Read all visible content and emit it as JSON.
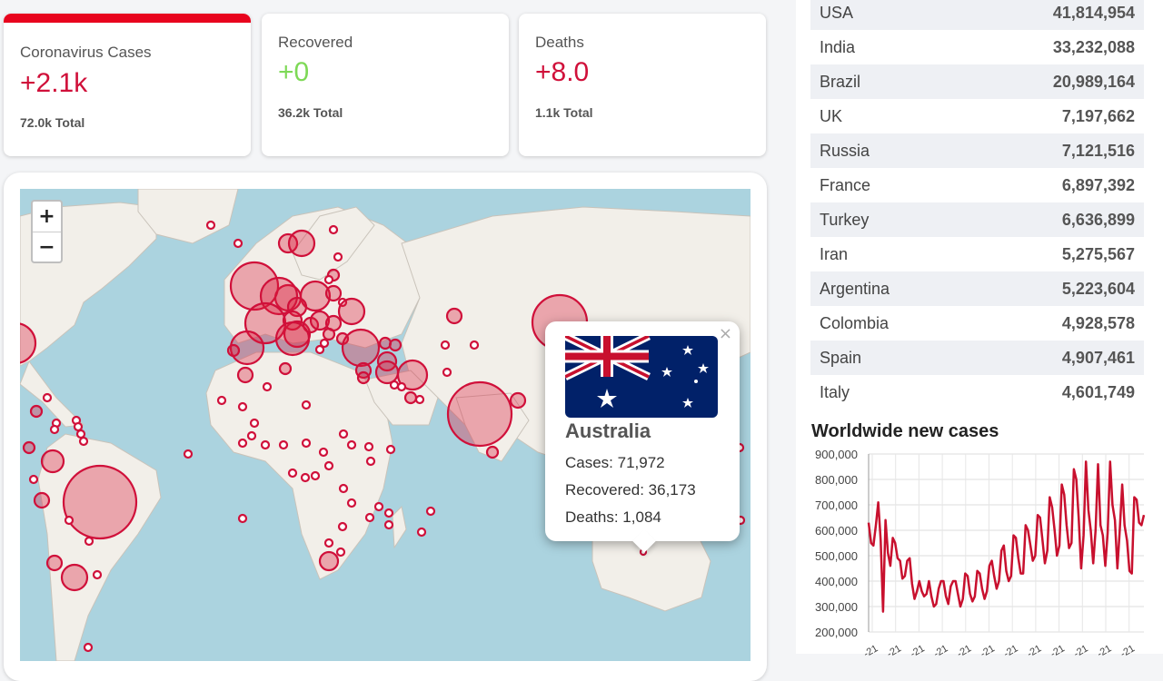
{
  "stats": {
    "cases": {
      "title": "Coronavirus Cases",
      "value": "+2.1k",
      "total": "72.0k Total"
    },
    "recovered": {
      "title": "Recovered",
      "value": "+0",
      "total": "36.2k Total"
    },
    "deaths": {
      "title": "Deaths",
      "value": "+8.0",
      "total": "1.1k Total"
    }
  },
  "map": {
    "zoom_in": "+",
    "zoom_out": "−",
    "popup": {
      "close": "×",
      "country": "Australia",
      "cases": "Cases: 71,972",
      "recovered": "Recovered: 36,173",
      "deaths": "Deaths: 1,084"
    }
  },
  "country_list": [
    {
      "name": "USA",
      "value": "41,814,954"
    },
    {
      "name": "India",
      "value": "33,232,088"
    },
    {
      "name": "Brazil",
      "value": "20,989,164"
    },
    {
      "name": "UK",
      "value": "7,197,662"
    },
    {
      "name": "Russia",
      "value": "7,121,516"
    },
    {
      "name": "France",
      "value": "6,897,392"
    },
    {
      "name": "Turkey",
      "value": "6,636,899"
    },
    {
      "name": "Iran",
      "value": "5,275,567"
    },
    {
      "name": "Argentina",
      "value": "5,223,604"
    },
    {
      "name": "Colombia",
      "value": "4,928,578"
    },
    {
      "name": "Spain",
      "value": "4,907,461"
    },
    {
      "name": "Italy",
      "value": "4,601,749"
    }
  ],
  "chart_title": "Worldwide new cases",
  "chart_data": {
    "type": "line",
    "title": "Worldwide new cases",
    "ylim": [
      200000,
      900000
    ],
    "ticks": [
      "900,000",
      "800,000",
      "700,000",
      "600,000",
      "500,000",
      "400,000",
      "300,000",
      "200,000"
    ],
    "x_tick_label": "-21",
    "series": [
      {
        "values": [
          630000,
          550000,
          540000,
          620000,
          710000,
          560000,
          280000,
          640000,
          510000,
          460000,
          570000,
          550000,
          490000,
          480000,
          410000,
          420000,
          480000,
          490000,
          390000,
          330000,
          360000,
          400000,
          360000,
          340000,
          350000,
          400000,
          340000,
          300000,
          310000,
          370000,
          400000,
          400000,
          340000,
          310000,
          380000,
          400000,
          400000,
          350000,
          300000,
          330000,
          430000,
          420000,
          350000,
          320000,
          340000,
          440000,
          430000,
          370000,
          330000,
          360000,
          460000,
          480000,
          420000,
          370000,
          400000,
          520000,
          540000,
          440000,
          400000,
          420000,
          580000,
          570000,
          490000,
          430000,
          430000,
          620000,
          600000,
          540000,
          480000,
          500000,
          660000,
          650000,
          560000,
          470000,
          520000,
          730000,
          690000,
          600000,
          500000,
          540000,
          780000,
          740000,
          620000,
          530000,
          550000,
          840000,
          800000,
          650000,
          450000,
          580000,
          870000,
          680000,
          600000,
          470000,
          600000,
          860000,
          620000,
          580000,
          460000,
          590000,
          870000,
          700000,
          640000,
          450000,
          600000,
          780000,
          620000,
          560000,
          440000,
          430000,
          730000,
          720000,
          630000,
          620000,
          660000
        ]
      }
    ]
  }
}
